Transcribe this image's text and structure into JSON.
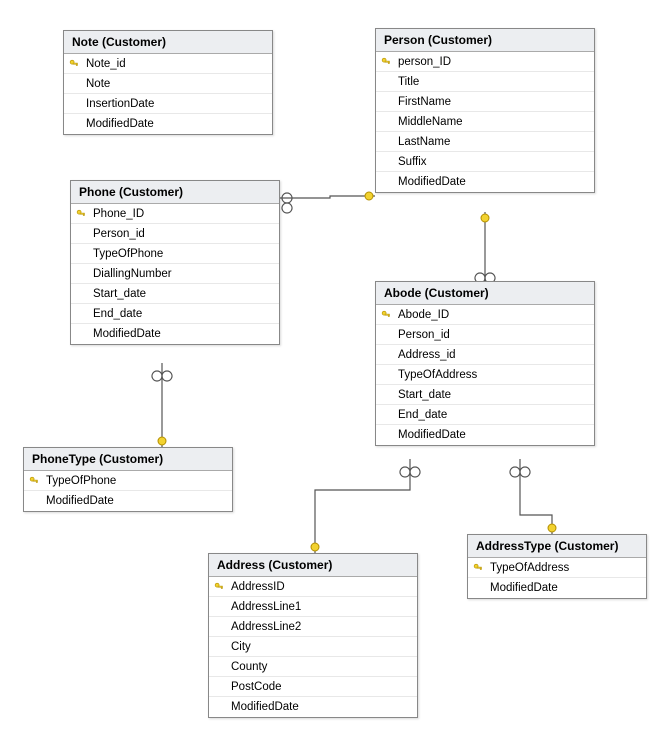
{
  "entities": {
    "note": {
      "title": "Note (Customer)",
      "fields": [
        {
          "name": "Note_id",
          "pk": true
        },
        {
          "name": "Note",
          "pk": false
        },
        {
          "name": "InsertionDate",
          "pk": false
        },
        {
          "name": "ModifiedDate",
          "pk": false
        }
      ]
    },
    "person": {
      "title": "Person (Customer)",
      "fields": [
        {
          "name": "person_ID",
          "pk": true
        },
        {
          "name": "Title",
          "pk": false
        },
        {
          "name": "FirstName",
          "pk": false
        },
        {
          "name": "MiddleName",
          "pk": false
        },
        {
          "name": "LastName",
          "pk": false
        },
        {
          "name": "Suffix",
          "pk": false
        },
        {
          "name": "ModifiedDate",
          "pk": false
        }
      ]
    },
    "phone": {
      "title": "Phone (Customer)",
      "fields": [
        {
          "name": "Phone_ID",
          "pk": true
        },
        {
          "name": "Person_id",
          "pk": false
        },
        {
          "name": "TypeOfPhone",
          "pk": false
        },
        {
          "name": "DiallingNumber",
          "pk": false
        },
        {
          "name": "Start_date",
          "pk": false
        },
        {
          "name": "End_date",
          "pk": false
        },
        {
          "name": "ModifiedDate",
          "pk": false
        }
      ]
    },
    "abode": {
      "title": "Abode (Customer)",
      "fields": [
        {
          "name": "Abode_ID",
          "pk": true
        },
        {
          "name": "Person_id",
          "pk": false
        },
        {
          "name": "Address_id",
          "pk": false
        },
        {
          "name": "TypeOfAddress",
          "pk": false
        },
        {
          "name": "Start_date",
          "pk": false
        },
        {
          "name": "End_date",
          "pk": false
        },
        {
          "name": "ModifiedDate",
          "pk": false
        }
      ]
    },
    "phonetype": {
      "title": "PhoneType (Customer)",
      "fields": [
        {
          "name": "TypeOfPhone",
          "pk": true
        },
        {
          "name": "ModifiedDate",
          "pk": false
        }
      ]
    },
    "address": {
      "title": "Address (Customer)",
      "fields": [
        {
          "name": "AddressID",
          "pk": true
        },
        {
          "name": "AddressLine1",
          "pk": false
        },
        {
          "name": "AddressLine2",
          "pk": false
        },
        {
          "name": "City",
          "pk": false
        },
        {
          "name": "County",
          "pk": false
        },
        {
          "name": "PostCode",
          "pk": false
        },
        {
          "name": "ModifiedDate",
          "pk": false
        }
      ]
    },
    "addresstype": {
      "title": "AddressType (Customer)",
      "fields": [
        {
          "name": "TypeOfAddress",
          "pk": true
        },
        {
          "name": "ModifiedDate",
          "pk": false
        }
      ]
    }
  },
  "relationships": [
    {
      "from": "Phone.Person_id",
      "to": "Person.person_ID",
      "cardinality": "many-to-one"
    },
    {
      "from": "Phone.TypeOfPhone",
      "to": "PhoneType.TypeOfPhone",
      "cardinality": "many-to-one"
    },
    {
      "from": "Abode.Person_id",
      "to": "Person.person_ID",
      "cardinality": "many-to-one"
    },
    {
      "from": "Abode.Address_id",
      "to": "Address.AddressID",
      "cardinality": "many-to-one"
    },
    {
      "from": "Abode.TypeOfAddress",
      "to": "AddressType.TypeOfAddress",
      "cardinality": "many-to-one"
    }
  ]
}
